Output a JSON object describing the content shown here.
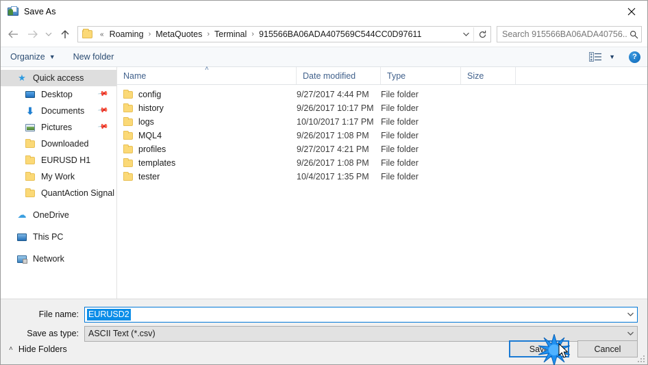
{
  "window": {
    "title": "Save As",
    "icon": "save-as-icon",
    "close_label": "✕"
  },
  "nav": {
    "back_icon": "arrow-left-icon",
    "forward_icon": "arrow-right-icon",
    "history_icon": "chevron-down-icon",
    "up_icon": "arrow-up-icon",
    "refresh_icon": "refresh-icon",
    "breadcrumb_prefix": "«",
    "crumbs": [
      "Roaming",
      "MetaQuotes",
      "Terminal",
      "915566BA06ADA407569C544CC0D97611"
    ],
    "separator": "›",
    "dropdown_icon": "chevron-down-icon"
  },
  "search": {
    "placeholder": "Search 915566BA06ADA40756...",
    "icon": "search-icon"
  },
  "toolbar": {
    "organize_label": "Organize",
    "organize_caret": "▼",
    "new_folder_label": "New folder",
    "view_icon": "view-options-icon",
    "view_caret": "▼",
    "help_label": "?"
  },
  "sidebar": {
    "items": [
      {
        "label": "Quick access",
        "icon": "star-icon",
        "selected": true,
        "indent": false,
        "pinned": false,
        "gap": false
      },
      {
        "label": "Desktop",
        "icon": "desktop-icon",
        "selected": false,
        "indent": true,
        "pinned": true,
        "gap": false
      },
      {
        "label": "Documents",
        "icon": "documents-icon",
        "selected": false,
        "indent": true,
        "pinned": true,
        "gap": false
      },
      {
        "label": "Pictures",
        "icon": "pictures-icon",
        "selected": false,
        "indent": true,
        "pinned": true,
        "gap": false
      },
      {
        "label": "Downloaded",
        "icon": "folder-icon",
        "selected": false,
        "indent": true,
        "pinned": false,
        "gap": false
      },
      {
        "label": "EURUSD H1",
        "icon": "folder-icon",
        "selected": false,
        "indent": true,
        "pinned": false,
        "gap": false
      },
      {
        "label": "My Work",
        "icon": "folder-icon",
        "selected": false,
        "indent": true,
        "pinned": false,
        "gap": false
      },
      {
        "label": "QuantAction Signal",
        "icon": "folder-icon",
        "selected": false,
        "indent": true,
        "pinned": false,
        "gap": false
      },
      {
        "label": "OneDrive",
        "icon": "cloud-icon",
        "selected": false,
        "indent": false,
        "pinned": false,
        "gap": true
      },
      {
        "label": "This PC",
        "icon": "this-pc-icon",
        "selected": false,
        "indent": false,
        "pinned": false,
        "gap": true
      },
      {
        "label": "Network",
        "icon": "network-icon",
        "selected": false,
        "indent": false,
        "pinned": false,
        "gap": true
      }
    ]
  },
  "filelist": {
    "columns": [
      "Name",
      "Date modified",
      "Type",
      "Size"
    ],
    "sort_column": "Name",
    "sort_indicator": "˄",
    "rows": [
      {
        "name": "config",
        "date": "9/27/2017 4:44 PM",
        "type": "File folder",
        "size": ""
      },
      {
        "name": "history",
        "date": "9/26/2017 10:17 PM",
        "type": "File folder",
        "size": ""
      },
      {
        "name": "logs",
        "date": "10/10/2017 1:17 PM",
        "type": "File folder",
        "size": ""
      },
      {
        "name": "MQL4",
        "date": "9/26/2017 1:08 PM",
        "type": "File folder",
        "size": ""
      },
      {
        "name": "profiles",
        "date": "9/27/2017 4:21 PM",
        "type": "File folder",
        "size": ""
      },
      {
        "name": "templates",
        "date": "9/26/2017 1:08 PM",
        "type": "File folder",
        "size": ""
      },
      {
        "name": "tester",
        "date": "10/4/2017 1:35 PM",
        "type": "File folder",
        "size": ""
      }
    ]
  },
  "footer": {
    "filename_label": "File name:",
    "filename_value": "EURUSD2",
    "filetype_label": "Save as type:",
    "filetype_value": "ASCII Text (*.csv)",
    "hide_folders_label": "Hide Folders",
    "hide_folders_caret": "˄",
    "save_label": "Save",
    "cancel_label": "Cancel"
  },
  "colors": {
    "accent": "#0078d7",
    "selection": "#0a8de8",
    "folder": "#fbd977",
    "header_text": "#41618c"
  }
}
